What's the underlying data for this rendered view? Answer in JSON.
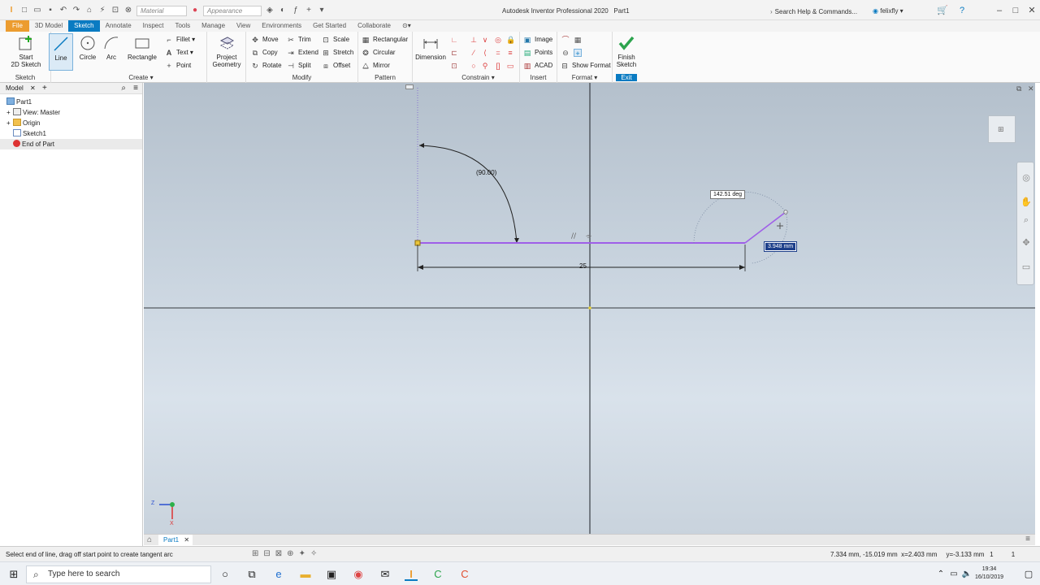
{
  "titlebar": {
    "app_title": "Autodesk Inventor Professional 2020",
    "document": "Part1",
    "material_placeholder": "Material",
    "appearance_placeholder": "Appearance",
    "search_placeholder": "Search Help & Commands...",
    "user": "felixfly"
  },
  "tabs": [
    "File",
    "3D Model",
    "Sketch",
    "Annotate",
    "Inspect",
    "Tools",
    "Manage",
    "View",
    "Environments",
    "Get Started",
    "Collaborate"
  ],
  "active_tab": "Sketch",
  "ribbon": {
    "sketch_panel": {
      "title": "Sketch",
      "start": "Start",
      "start2": "2D Sketch"
    },
    "create_panel": {
      "title": "Create",
      "line": "Line",
      "circle": "Circle",
      "arc": "Arc",
      "rectangle": "Rectangle",
      "fillet": "Fillet",
      "text": "Text",
      "point": "Point"
    },
    "project": {
      "label1": "Project",
      "label2": "Geometry"
    },
    "modify_panel": {
      "title": "Modify",
      "move": "Move",
      "copy": "Copy",
      "rotate": "Rotate",
      "trim": "Trim",
      "extend": "Extend",
      "split": "Split",
      "scale": "Scale",
      "stretch": "Stretch",
      "offset": "Offset"
    },
    "pattern_panel": {
      "title": "Pattern",
      "rectangular": "Rectangular",
      "circular": "Circular",
      "mirror": "Mirror"
    },
    "constrain_panel": {
      "title": "Constrain",
      "dimension": "Dimension"
    },
    "insert_panel": {
      "title": "Insert",
      "image": "Image",
      "points": "Points",
      "acad": "ACAD"
    },
    "format_panel": {
      "title": "Format",
      "show_format": "Show Format"
    },
    "exit_panel": {
      "title": "Exit",
      "finish1": "Finish",
      "finish2": "Sketch"
    }
  },
  "browser": {
    "tab_label": "Model",
    "items": [
      {
        "label": "Part1"
      },
      {
        "label": "View: Master"
      },
      {
        "label": "Origin"
      },
      {
        "label": "Sketch1"
      },
      {
        "label": "End of Part"
      }
    ]
  },
  "canvas": {
    "angle_dim": "(90.00)",
    "length_dim": "25",
    "angle_input": "142.51 deg",
    "length_input": "3.948 mm",
    "axis_z": "Z",
    "axis_x": "X"
  },
  "doc_tabs": {
    "part1": "Part1"
  },
  "status": {
    "message": "Select end of line, drag off start point to create tangent arc",
    "coords": "7.334 mm, -15.019 mm  x=2.403 mm     y=-3.133 mm   1          1"
  },
  "taskbar": {
    "search_placeholder": "Type here to search",
    "time": "19:34",
    "date": "16/10/2019"
  },
  "colors": {
    "accent": "#0a7bc2",
    "file_tab": "#ec9c2f",
    "sketch_line": "#9f5fe8",
    "finish_check": "#2da44e"
  }
}
